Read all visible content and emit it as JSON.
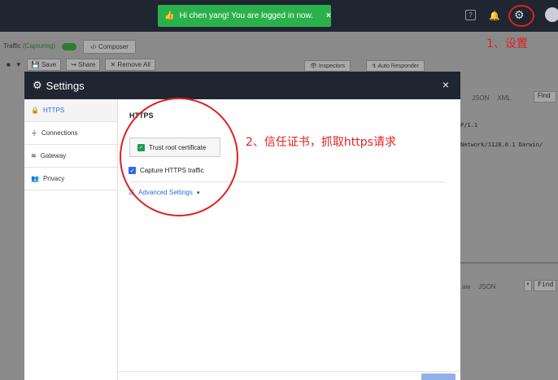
{
  "header": {
    "toast_text": "Hi chen yang! You are logged in now.",
    "toast_close": "×",
    "icons": [
      "help-icon",
      "bell-icon",
      "gear-icon",
      "avatar-icon"
    ]
  },
  "background_app": {
    "traffic_label": "Traffic",
    "capturing_label": "(Capturing)",
    "composer_tab": "Composer",
    "toolbar": {
      "save": "Save",
      "share": "Share",
      "remove_all": "Remove All"
    },
    "inspectors_tab": "Inspectors",
    "auto_responder_tab": "Auto Responder",
    "right_tabs": [
      "JSON",
      "XML"
    ],
    "find_label": "Find",
    "response_lines": [
      "P/1.1",
      "Network/1128.0.1 Darwin/"
    ],
    "right_tabs_bottom": [
      "aw",
      "JSON"
    ],
    "find_label_bottom": "Find"
  },
  "modal": {
    "title": "Settings",
    "close": "×",
    "sidebar": [
      {
        "label": "HTTPS",
        "icon": "lock-icon",
        "active": true
      },
      {
        "label": "Connections",
        "icon": "plug-icon",
        "active": false
      },
      {
        "label": "Gateway",
        "icon": "wifi-icon",
        "active": false
      },
      {
        "label": "Privacy",
        "icon": "users-icon",
        "active": false
      }
    ],
    "section_title": "HTTPS",
    "trust_button": "Trust root certificate",
    "capture_label": "Capture HTTPS traffic",
    "capture_checked": true,
    "advanced_settings": "Advanced Settings"
  },
  "annotations": {
    "note1": "1、设置",
    "note2": "2、信任证书，抓取https请求",
    "color": "#e02020"
  }
}
